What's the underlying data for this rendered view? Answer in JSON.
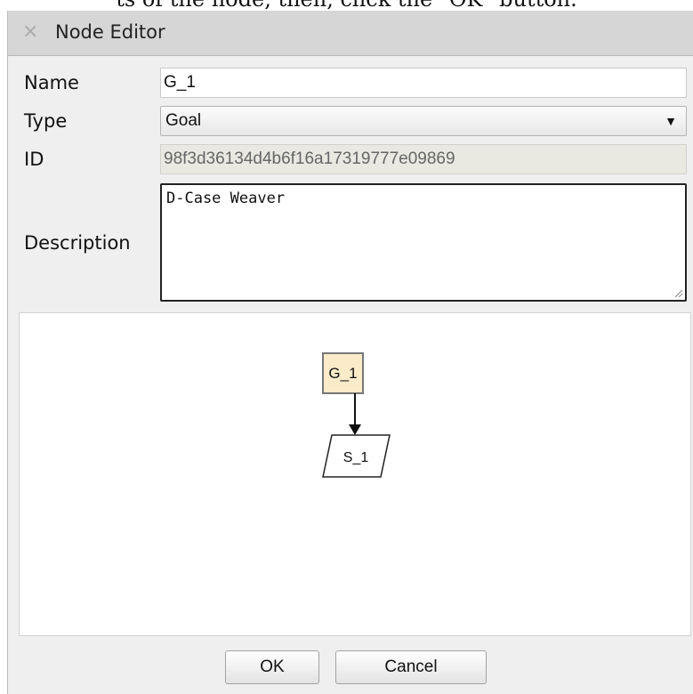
{
  "top_text": "ts of the node, then, click the \"OK\" button.",
  "dialog": {
    "title": "Node Editor",
    "close_icon": "×",
    "name_label": "Name",
    "name_value": "G_1",
    "type_label": "Type",
    "type_value": "Goal",
    "type_arrow": "▼",
    "id_label": "ID",
    "id_value": "98f3d36134d4b6f16a17319777e09869",
    "description_label": "Description",
    "description_value": "D-Case Weaver",
    "ok_label": "OK",
    "cancel_label": "Cancel"
  },
  "diagram": {
    "goal_node": "G_1",
    "strategy_node": "S_1",
    "goal_fill": "#fcebc9"
  }
}
